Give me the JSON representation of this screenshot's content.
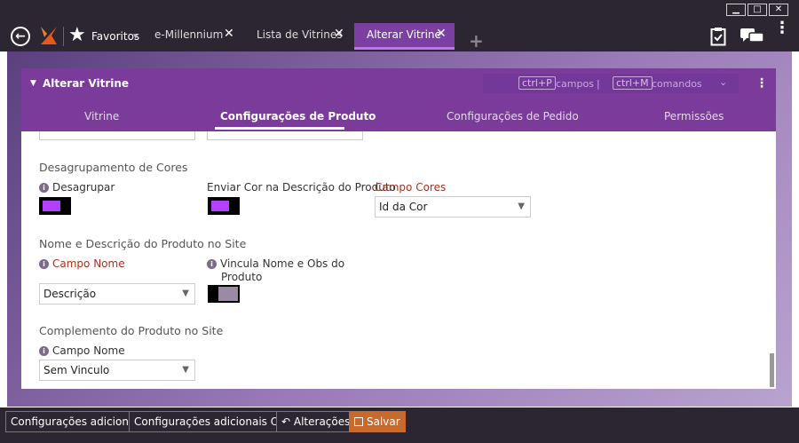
{
  "window": {
    "minimize": "▁",
    "restore": "□",
    "close": "✕"
  },
  "favorites": {
    "label": "Favoritos",
    "caret": "▾"
  },
  "tabs": [
    {
      "label": "e-Millennium"
    },
    {
      "label": "Lista de Vitrines"
    },
    {
      "label": "Alterar Vitrine"
    }
  ],
  "panel": {
    "title": "Alterar Vitrine",
    "shortcuts": {
      "campos_key": "ctrl+P",
      "campos_label": "campos",
      "separator": "|",
      "comandos_key": "ctrl+M",
      "comandos_label": "comandos"
    },
    "tabs": [
      "Vitrine",
      "Configurações de Produto",
      "Configurações de Pedido",
      "Permissões"
    ]
  },
  "sections": {
    "desagrupamento": {
      "title": "Desagrupamento de Cores",
      "desagrupar_label": "Desagrupar",
      "enviar_cor_label": "Enviar Cor na Descrição do Produto",
      "campo_cores_label": "Campo Cores",
      "campo_cores_value": "Id da Cor"
    },
    "nome_descricao": {
      "title": "Nome e Descrição do Produto no Site",
      "campo_nome_label": "Campo Nome",
      "campo_nome_value": "Descrição",
      "vincula_label_line1": "Vincula Nome e Obs do",
      "vincula_label_line2": "Produto"
    },
    "complemento": {
      "title": "Complemento do Produto no Site",
      "campo_nome_label": "Campo Nome",
      "campo_nome_value": "Sem Vinculo"
    }
  },
  "toggles": {
    "desagrupar": true,
    "enviar_cor": true,
    "vincula": false
  },
  "footer": {
    "config_adicionais": "Configurações adicionais",
    "config_adicionais_oms": "Configurações adicionais OMS",
    "alteracoes": "Alterações",
    "salvar": "Salvar"
  },
  "colors": {
    "accent": "#7b3b9a",
    "toggle_on": "#b440ff",
    "required_label": "#a8321d",
    "save_button": "#c86a2b"
  }
}
